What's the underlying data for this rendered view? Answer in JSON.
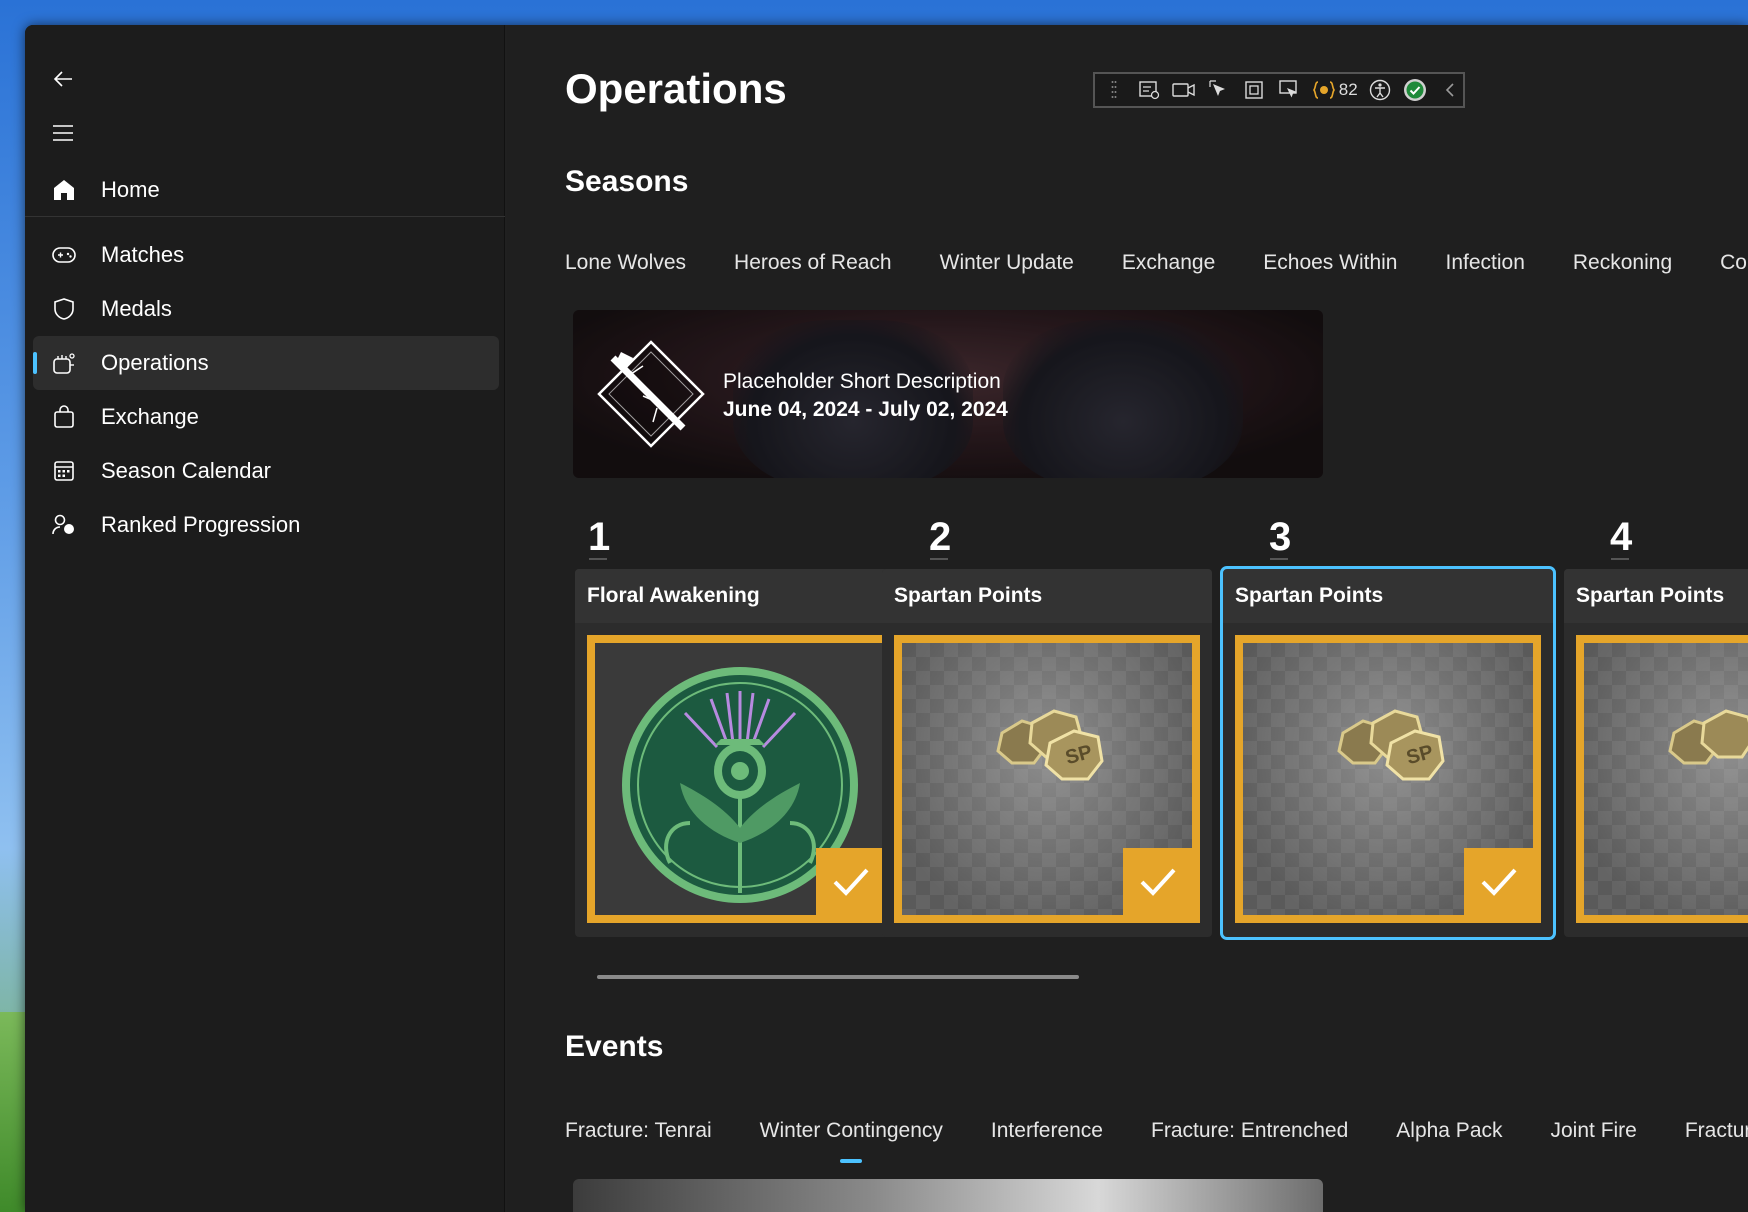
{
  "colors": {
    "accent": "#4cc2ff",
    "reward_frame": "#e5a52a",
    "background": "#1f1f1f",
    "sidebar": "#1c1c1c"
  },
  "sidebar": {
    "back_icon": "arrow-left-icon",
    "menu_icon": "hamburger-menu-icon",
    "items": [
      {
        "label": "Home",
        "icon": "home-icon"
      },
      {
        "label": "Matches",
        "icon": "gamepad-icon"
      },
      {
        "label": "Medals",
        "icon": "shield-icon"
      },
      {
        "label": "Operations",
        "icon": "operations-icon",
        "active": true
      },
      {
        "label": "Exchange",
        "icon": "shopping-bag-icon"
      },
      {
        "label": "Season Calendar",
        "icon": "calendar-icon"
      },
      {
        "label": "Ranked Progression",
        "icon": "ranked-progression-icon"
      }
    ]
  },
  "page": {
    "title": "Operations"
  },
  "debug_toolbar": {
    "count": "82"
  },
  "seasons": {
    "title": "Seasons",
    "tabs": [
      "Lone Wolves",
      "Heroes of Reach",
      "Winter Update",
      "Exchange",
      "Echoes Within",
      "Infection",
      "Reckoning",
      "Combir"
    ],
    "banner": {
      "description": "Placeholder Short Description",
      "date_range": "June 04, 2024 - July 02, 2024"
    },
    "rewards": [
      {
        "rank": "1",
        "title": "Floral Awakening",
        "type": "emblem",
        "claimed": true
      },
      {
        "rank": "2",
        "title": "Spartan Points",
        "type": "spartan-points",
        "claimed": true
      },
      {
        "rank": "3",
        "title": "Spartan Points",
        "type": "spartan-points",
        "claimed": true,
        "selected": true
      },
      {
        "rank": "4",
        "title": "Spartan Points",
        "type": "spartan-points",
        "claimed": false
      }
    ]
  },
  "events": {
    "title": "Events",
    "tabs": [
      "Fracture: Tenrai",
      "Winter Contingency",
      "Interference",
      "Fracture: Entrenched",
      "Alpha Pack",
      "Joint Fire",
      "Fracture: Fi"
    ],
    "active_tab": "Winter Contingency"
  }
}
